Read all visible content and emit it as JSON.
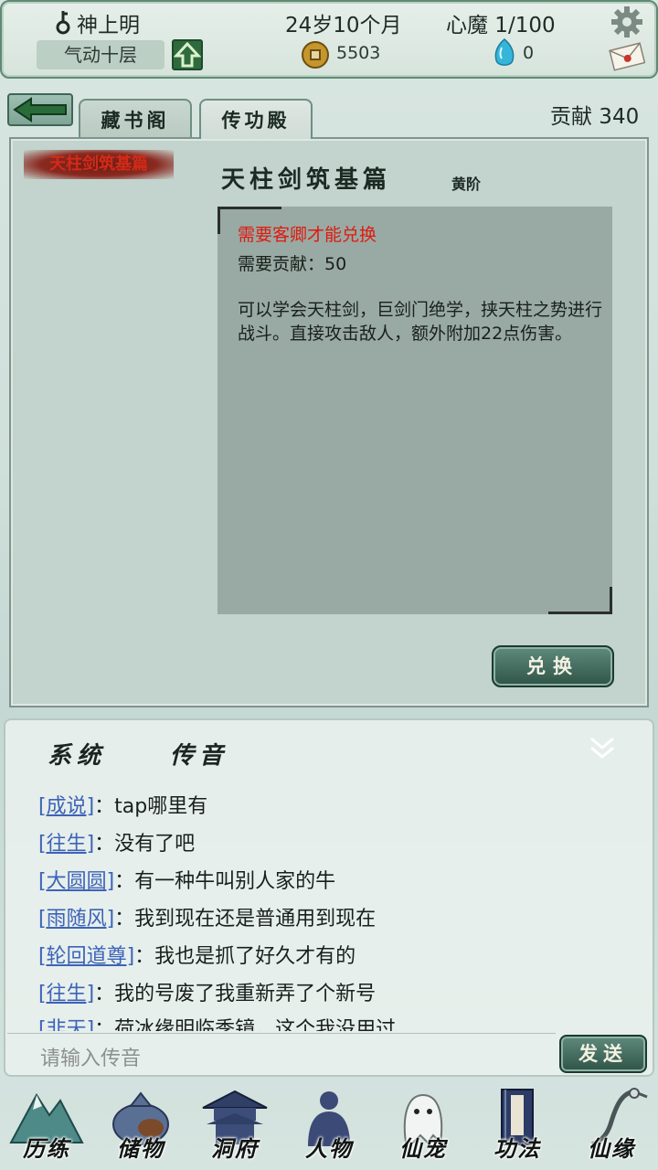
{
  "header": {
    "name": "神上明",
    "realm": "气动十层",
    "age": "24岁10个月",
    "heart_demon": "心魔  1/100",
    "coins": "5503",
    "spirit_stones": "0",
    "icons": [
      "key-icon",
      "level-up-arrow-icon",
      "gear-icon",
      "coin-icon",
      "spirit-stone-icon",
      "mail-icon"
    ]
  },
  "tabs": {
    "back": "back-arrow-icon",
    "items": [
      "藏书阁",
      "传功殿"
    ],
    "active": "传功殿",
    "contribution": "贡献 340"
  },
  "skill": {
    "tag": "天柱剑筑基篇",
    "title": "天柱剑筑基篇",
    "grade": "黄阶",
    "requirement_note": "需要客卿才能兑换",
    "requirement_contribution": "需要贡献：50",
    "description": "可以学会天柱剑，巨剑门绝学，挟天柱之势进行战斗。直接攻击敌人，额外附加22点伤害。",
    "exchange_button": "兑换"
  },
  "chat": {
    "tabs": [
      "系统",
      "传音"
    ],
    "messages": [
      {
        "nick": "[成说]",
        "text": "：tap哪里有"
      },
      {
        "nick": "[往生]",
        "text": "：没有了吧"
      },
      {
        "nick": "[大圆圆]",
        "text": "：有一种牛叫别人家的牛"
      },
      {
        "nick": "[雨随风]",
        "text": "：我到现在还是普通用到现在"
      },
      {
        "nick": "[轮回道尊]",
        "text": "：我也是抓了好久才有的"
      },
      {
        "nick": "[往生]",
        "text": "：我的号废了我重新弄了个新号"
      },
      {
        "nick": "[非天]",
        "text": "：荷冰缘明临季镜，这个我没用过"
      }
    ],
    "input_placeholder": "请输入传音",
    "send_button": "发送"
  },
  "nav": {
    "items": [
      "历练",
      "储物",
      "洞府",
      "人物",
      "仙宠",
      "功法",
      "仙缘"
    ]
  },
  "colors": {
    "accent_green": "#2f5447",
    "warning_red": "#e01a10",
    "nick_blue": "#3d63b8"
  }
}
